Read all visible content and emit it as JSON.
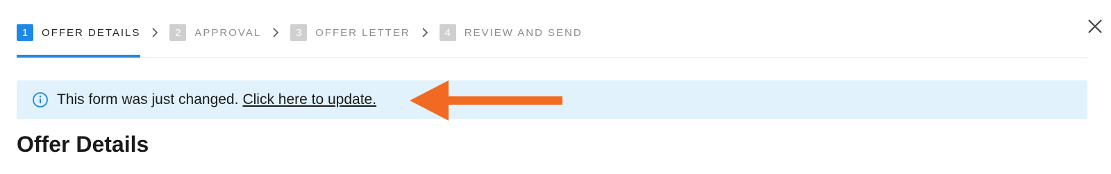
{
  "stepper": {
    "steps": [
      {
        "number": "1",
        "label": "OFFER DETAILS",
        "active": true
      },
      {
        "number": "2",
        "label": "APPROVAL",
        "active": false
      },
      {
        "number": "3",
        "label": "OFFER LETTER",
        "active": false
      },
      {
        "number": "4",
        "label": "REVIEW AND SEND",
        "active": false
      }
    ],
    "separator_icon": "chevron-right-icon",
    "active_color": "#1e88e5",
    "inactive_color": "#cfcfcf"
  },
  "header": {
    "close_icon": "close-icon"
  },
  "banner": {
    "icon": "info-icon",
    "message": "This form was just changed.",
    "link_text": "Click here to update.",
    "background": "#e1f2fd"
  },
  "annotation": {
    "icon": "arrow-left-icon",
    "color": "#f26a21"
  },
  "main": {
    "title": "Offer Details"
  }
}
